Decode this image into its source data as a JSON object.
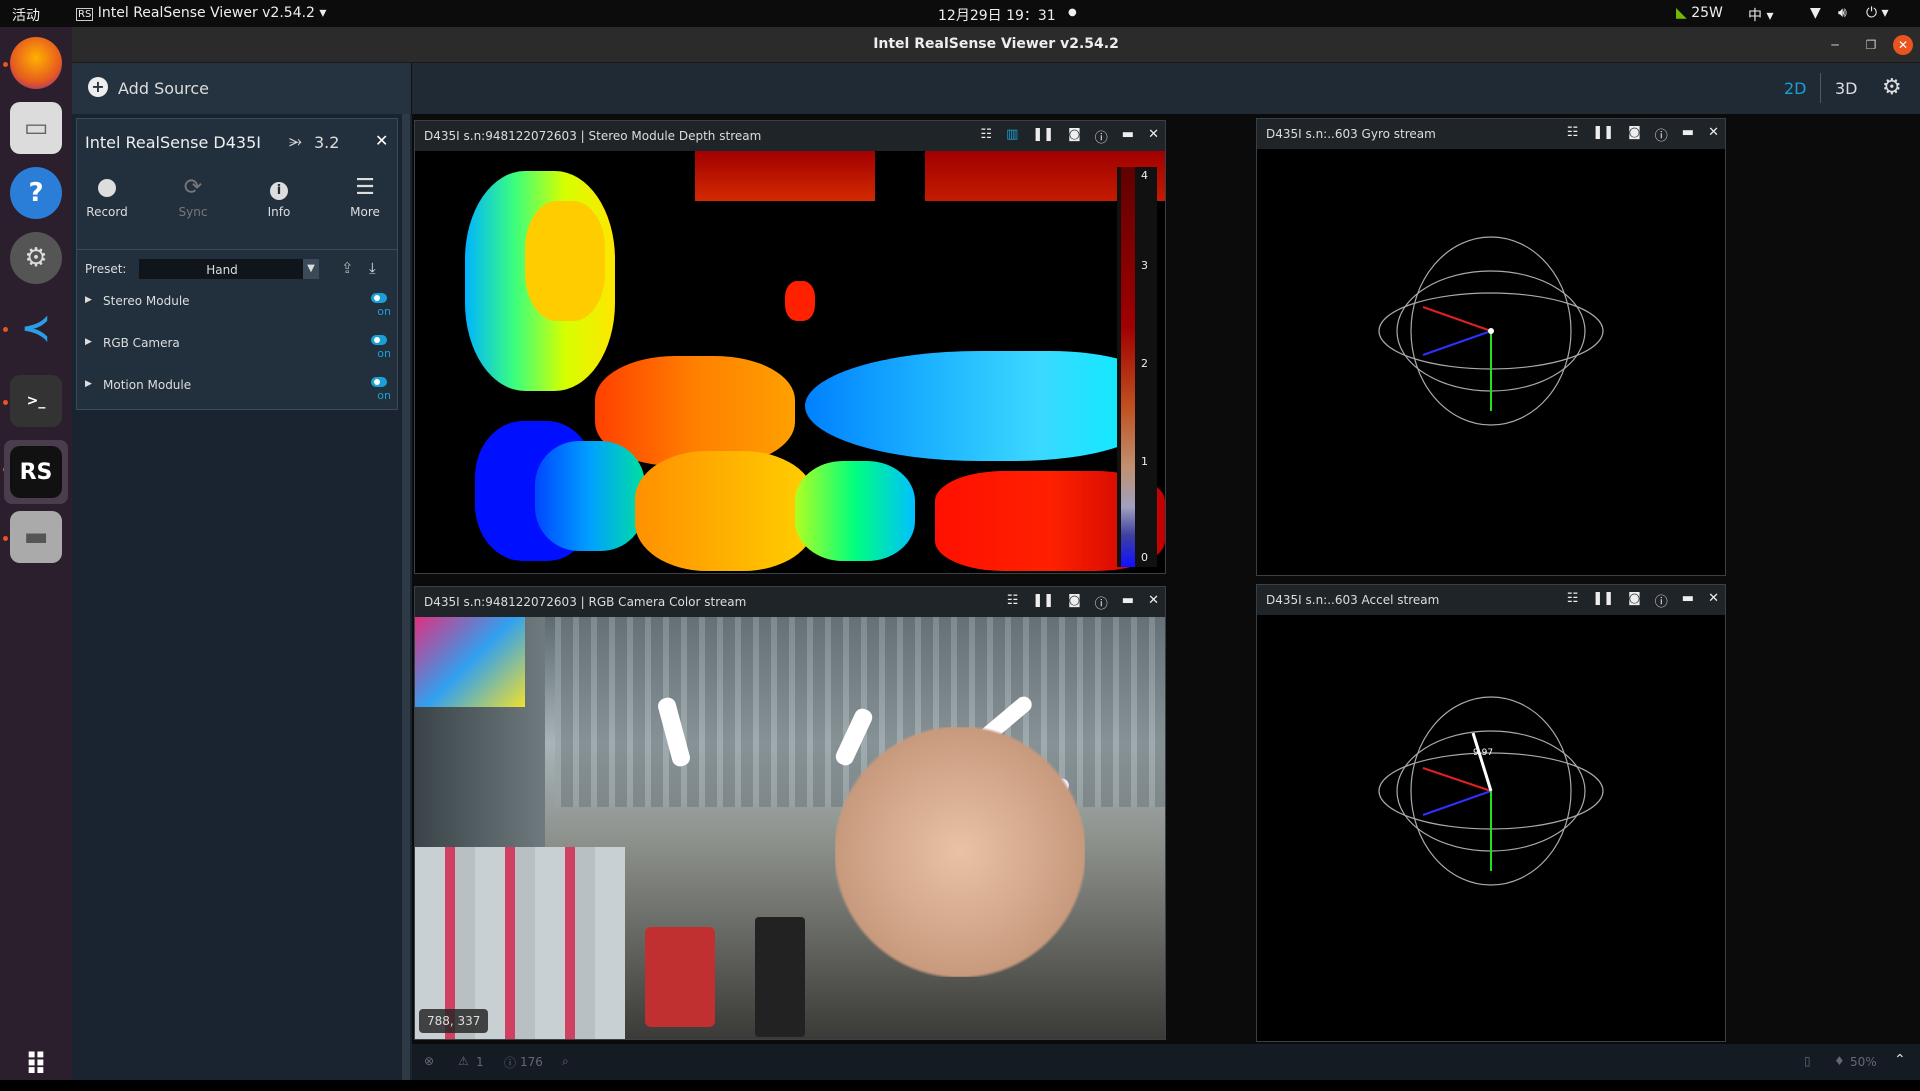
{
  "topbar": {
    "activities": "活动",
    "app_menu": "Intel RealSense Viewer v2.54.2",
    "clock": "12月29日  19：31",
    "power": "25W",
    "input_method": "中"
  },
  "window": {
    "title": "Intel RealSense Viewer v2.54.2"
  },
  "toolbar": {
    "add_source": "Add Source",
    "mode_2d": "2D",
    "mode_3d": "3D"
  },
  "device": {
    "name": "Intel RealSense D435I",
    "usb": "3.2",
    "actions": [
      {
        "label": "Record",
        "icon": "record-icon"
      },
      {
        "label": "Sync",
        "icon": "sync-icon"
      },
      {
        "label": "Info",
        "icon": "info-icon"
      },
      {
        "label": "More",
        "icon": "hamburger-icon"
      }
    ],
    "preset_label": "Preset:",
    "preset_value": "Hand",
    "modules": [
      {
        "name": "Stereo Module",
        "state": "on"
      },
      {
        "name": "RGB Camera",
        "state": "on"
      },
      {
        "name": "Motion Module",
        "state": "on"
      }
    ]
  },
  "streams": {
    "depth": {
      "title": "D435I s.n:948122072603 | Stereo Module Depth stream",
      "scale": [
        "4",
        "3",
        "2",
        "1",
        "0"
      ]
    },
    "color": {
      "title": "D435I s.n:948122072603 | RGB Camera Color stream",
      "coords": "788, 337"
    },
    "gyro": {
      "title": "D435I s.n:..603 Gyro stream"
    },
    "accel": {
      "title": "D435I s.n:..603 Accel stream",
      "value": "9.97"
    }
  },
  "statusbar": {
    "warnings": "1",
    "infos": "176",
    "usage": "50%"
  },
  "colors": {
    "accent": "#1a9fd6",
    "panel": "#1a2430"
  }
}
